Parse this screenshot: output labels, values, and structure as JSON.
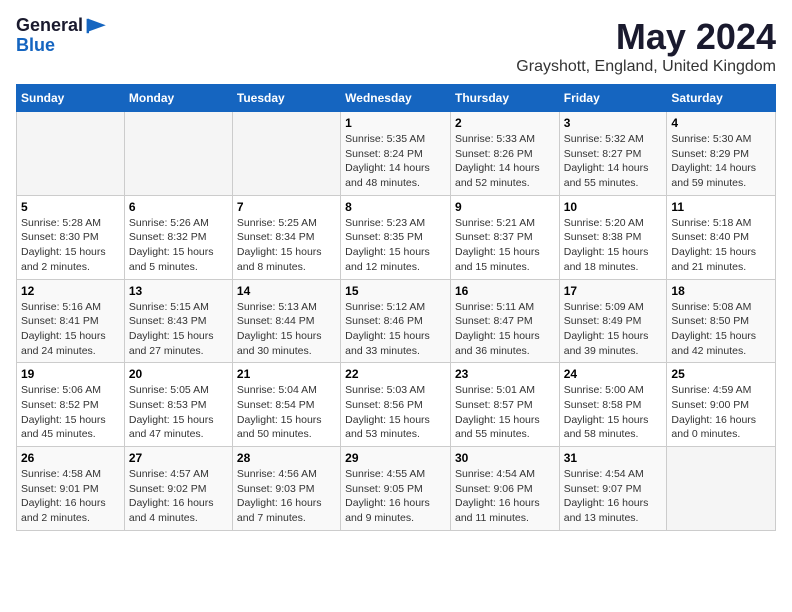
{
  "header": {
    "logo_line1": "General",
    "logo_line2": "Blue",
    "month_year": "May 2024",
    "location": "Grayshott, England, United Kingdom"
  },
  "weekdays": [
    "Sunday",
    "Monday",
    "Tuesday",
    "Wednesday",
    "Thursday",
    "Friday",
    "Saturday"
  ],
  "weeks": [
    [
      {
        "day": "",
        "info": ""
      },
      {
        "day": "",
        "info": ""
      },
      {
        "day": "",
        "info": ""
      },
      {
        "day": "1",
        "info": "Sunrise: 5:35 AM\nSunset: 8:24 PM\nDaylight: 14 hours\nand 48 minutes."
      },
      {
        "day": "2",
        "info": "Sunrise: 5:33 AM\nSunset: 8:26 PM\nDaylight: 14 hours\nand 52 minutes."
      },
      {
        "day": "3",
        "info": "Sunrise: 5:32 AM\nSunset: 8:27 PM\nDaylight: 14 hours\nand 55 minutes."
      },
      {
        "day": "4",
        "info": "Sunrise: 5:30 AM\nSunset: 8:29 PM\nDaylight: 14 hours\nand 59 minutes."
      }
    ],
    [
      {
        "day": "5",
        "info": "Sunrise: 5:28 AM\nSunset: 8:30 PM\nDaylight: 15 hours\nand 2 minutes."
      },
      {
        "day": "6",
        "info": "Sunrise: 5:26 AM\nSunset: 8:32 PM\nDaylight: 15 hours\nand 5 minutes."
      },
      {
        "day": "7",
        "info": "Sunrise: 5:25 AM\nSunset: 8:34 PM\nDaylight: 15 hours\nand 8 minutes."
      },
      {
        "day": "8",
        "info": "Sunrise: 5:23 AM\nSunset: 8:35 PM\nDaylight: 15 hours\nand 12 minutes."
      },
      {
        "day": "9",
        "info": "Sunrise: 5:21 AM\nSunset: 8:37 PM\nDaylight: 15 hours\nand 15 minutes."
      },
      {
        "day": "10",
        "info": "Sunrise: 5:20 AM\nSunset: 8:38 PM\nDaylight: 15 hours\nand 18 minutes."
      },
      {
        "day": "11",
        "info": "Sunrise: 5:18 AM\nSunset: 8:40 PM\nDaylight: 15 hours\nand 21 minutes."
      }
    ],
    [
      {
        "day": "12",
        "info": "Sunrise: 5:16 AM\nSunset: 8:41 PM\nDaylight: 15 hours\nand 24 minutes."
      },
      {
        "day": "13",
        "info": "Sunrise: 5:15 AM\nSunset: 8:43 PM\nDaylight: 15 hours\nand 27 minutes."
      },
      {
        "day": "14",
        "info": "Sunrise: 5:13 AM\nSunset: 8:44 PM\nDaylight: 15 hours\nand 30 minutes."
      },
      {
        "day": "15",
        "info": "Sunrise: 5:12 AM\nSunset: 8:46 PM\nDaylight: 15 hours\nand 33 minutes."
      },
      {
        "day": "16",
        "info": "Sunrise: 5:11 AM\nSunset: 8:47 PM\nDaylight: 15 hours\nand 36 minutes."
      },
      {
        "day": "17",
        "info": "Sunrise: 5:09 AM\nSunset: 8:49 PM\nDaylight: 15 hours\nand 39 minutes."
      },
      {
        "day": "18",
        "info": "Sunrise: 5:08 AM\nSunset: 8:50 PM\nDaylight: 15 hours\nand 42 minutes."
      }
    ],
    [
      {
        "day": "19",
        "info": "Sunrise: 5:06 AM\nSunset: 8:52 PM\nDaylight: 15 hours\nand 45 minutes."
      },
      {
        "day": "20",
        "info": "Sunrise: 5:05 AM\nSunset: 8:53 PM\nDaylight: 15 hours\nand 47 minutes."
      },
      {
        "day": "21",
        "info": "Sunrise: 5:04 AM\nSunset: 8:54 PM\nDaylight: 15 hours\nand 50 minutes."
      },
      {
        "day": "22",
        "info": "Sunrise: 5:03 AM\nSunset: 8:56 PM\nDaylight: 15 hours\nand 53 minutes."
      },
      {
        "day": "23",
        "info": "Sunrise: 5:01 AM\nSunset: 8:57 PM\nDaylight: 15 hours\nand 55 minutes."
      },
      {
        "day": "24",
        "info": "Sunrise: 5:00 AM\nSunset: 8:58 PM\nDaylight: 15 hours\nand 58 minutes."
      },
      {
        "day": "25",
        "info": "Sunrise: 4:59 AM\nSunset: 9:00 PM\nDaylight: 16 hours\nand 0 minutes."
      }
    ],
    [
      {
        "day": "26",
        "info": "Sunrise: 4:58 AM\nSunset: 9:01 PM\nDaylight: 16 hours\nand 2 minutes."
      },
      {
        "day": "27",
        "info": "Sunrise: 4:57 AM\nSunset: 9:02 PM\nDaylight: 16 hours\nand 4 minutes."
      },
      {
        "day": "28",
        "info": "Sunrise: 4:56 AM\nSunset: 9:03 PM\nDaylight: 16 hours\nand 7 minutes."
      },
      {
        "day": "29",
        "info": "Sunrise: 4:55 AM\nSunset: 9:05 PM\nDaylight: 16 hours\nand 9 minutes."
      },
      {
        "day": "30",
        "info": "Sunrise: 4:54 AM\nSunset: 9:06 PM\nDaylight: 16 hours\nand 11 minutes."
      },
      {
        "day": "31",
        "info": "Sunrise: 4:54 AM\nSunset: 9:07 PM\nDaylight: 16 hours\nand 13 minutes."
      },
      {
        "day": "",
        "info": ""
      }
    ]
  ]
}
